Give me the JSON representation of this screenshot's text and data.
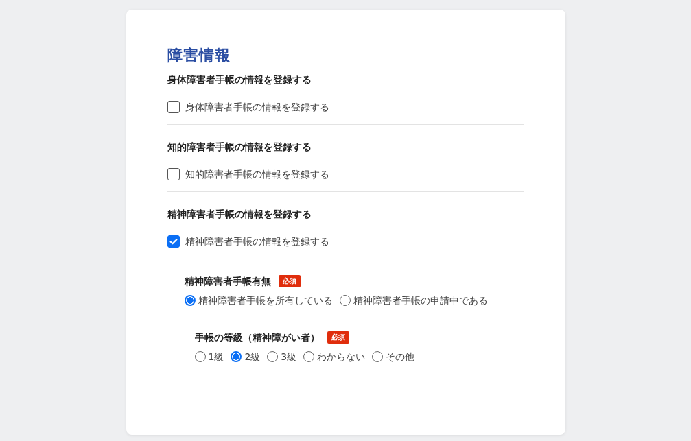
{
  "title": "障害情報",
  "sections": [
    {
      "heading": "身体障害者手帳の情報を登録する",
      "checkbox": {
        "label": "身体障害者手帳の情報を登録する",
        "checked": false
      }
    },
    {
      "heading": "知的障害者手帳の情報を登録する",
      "checkbox": {
        "label": "知的障害者手帳の情報を登録する",
        "checked": false
      }
    },
    {
      "heading": "精神障害者手帳の情報を登録する",
      "checkbox": {
        "label": "精神障害者手帳の情報を登録する",
        "checked": true
      }
    }
  ],
  "fields": [
    {
      "label": "精神障害者手帳有無",
      "badge": "必須",
      "options": [
        {
          "label": "精神障害者手帳を所有している",
          "selected": true
        },
        {
          "label": "精神障害者手帳の申請中である",
          "selected": false
        }
      ]
    },
    {
      "label": "手帳の等級（精神障がい者）",
      "badge": "必須",
      "options": [
        {
          "label": "1級",
          "selected": false
        },
        {
          "label": "2級",
          "selected": true
        },
        {
          "label": "3級",
          "selected": false
        },
        {
          "label": "わからない",
          "selected": false
        },
        {
          "label": "その他",
          "selected": false
        }
      ]
    }
  ]
}
